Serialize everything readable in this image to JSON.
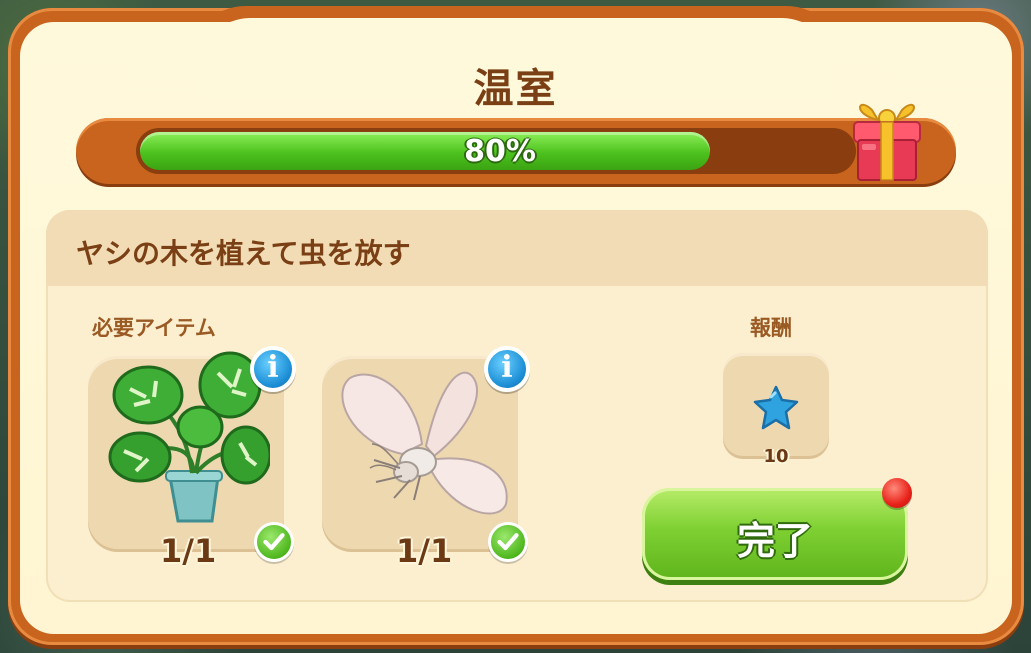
{
  "dialog": {
    "title": "温室",
    "progress": {
      "percent_label": "80%",
      "value": 0.8
    }
  },
  "task": {
    "title": "ヤシの木を植えて虫を放す",
    "required_label": "必要アイテム",
    "reward_label": "報酬",
    "items": [
      {
        "name": "monstera-plant",
        "count": "1/1",
        "complete": true
      },
      {
        "name": "white-moth",
        "count": "1/1",
        "complete": true
      }
    ],
    "reward": {
      "icon": "blue-star-icon",
      "count": "10"
    },
    "complete_button": "完了"
  },
  "colors": {
    "frame": "#c8641e",
    "panel": "#fff9dc",
    "progress_fill": "#4dc21e",
    "title_text": "#7a3f14",
    "info_blue": "#1d8fd6",
    "star_blue": "#2fa3e0"
  }
}
